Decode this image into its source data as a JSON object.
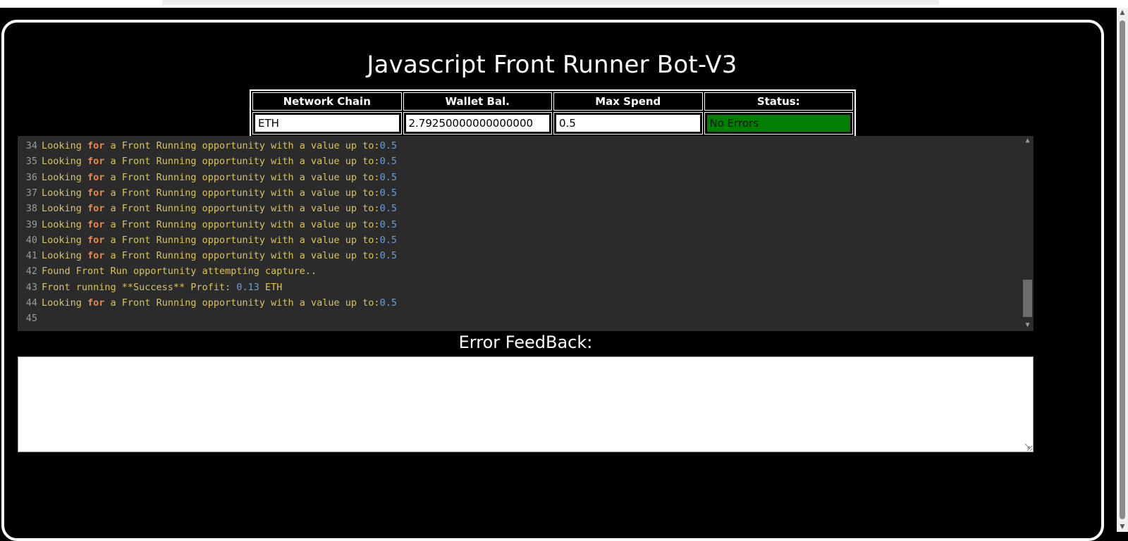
{
  "page": {
    "title": "Javascript Front Runner Bot-V3"
  },
  "info_table": {
    "headers": [
      "Network Chain",
      "Wallet Bal.",
      "Max Spend",
      "Status:"
    ],
    "values": {
      "network": "ETH",
      "wallet_balance": "2.79250000000000000",
      "max_spend": "0.5",
      "status": "No Errors"
    },
    "status_color": "#008000"
  },
  "console": {
    "lines": [
      {
        "n": "34",
        "pre": "Looking ",
        "kw": "for",
        "mid": " a Front Running opportunity with a value up to:",
        "num": "0.5",
        "post": ""
      },
      {
        "n": "35",
        "pre": "Looking ",
        "kw": "for",
        "mid": " a Front Running opportunity with a value up to:",
        "num": "0.5",
        "post": ""
      },
      {
        "n": "36",
        "pre": "Looking ",
        "kw": "for",
        "mid": " a Front Running opportunity with a value up to:",
        "num": "0.5",
        "post": ""
      },
      {
        "n": "37",
        "pre": "Looking ",
        "kw": "for",
        "mid": " a Front Running opportunity with a value up to:",
        "num": "0.5",
        "post": ""
      },
      {
        "n": "38",
        "pre": "Looking ",
        "kw": "for",
        "mid": " a Front Running opportunity with a value up to:",
        "num": "0.5",
        "post": ""
      },
      {
        "n": "39",
        "pre": "Looking ",
        "kw": "for",
        "mid": " a Front Running opportunity with a value up to:",
        "num": "0.5",
        "post": ""
      },
      {
        "n": "40",
        "pre": "Looking ",
        "kw": "for",
        "mid": " a Front Running opportunity with a value up to:",
        "num": "0.5",
        "post": ""
      },
      {
        "n": "41",
        "pre": "Looking ",
        "kw": "for",
        "mid": " a Front Running opportunity with a value up to:",
        "num": "0.5",
        "post": ""
      },
      {
        "n": "42",
        "pre": "Found Front Run opportunity attempting capture..",
        "kw": "",
        "mid": "",
        "num": "",
        "post": ""
      },
      {
        "n": "43",
        "pre": "Front running **Success** Profit: ",
        "kw": "",
        "mid": "",
        "num": "0.13",
        "post": " ETH"
      },
      {
        "n": "44",
        "pre": "Looking ",
        "kw": "for",
        "mid": " a Front Running opportunity with a value up to:",
        "num": "0.5",
        "post": ""
      },
      {
        "n": "45",
        "pre": "",
        "kw": "",
        "mid": "",
        "num": "",
        "post": ""
      }
    ],
    "colors": {
      "text": "#d7c45a",
      "keyword": "#e7894a",
      "number": "#6b9fd6",
      "gutter": "#9a9a9a",
      "background": "#2b2b2b"
    }
  },
  "feedback": {
    "label": "Error FeedBack:",
    "value": ""
  }
}
